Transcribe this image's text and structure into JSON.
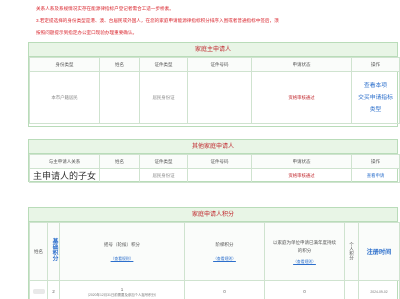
{
  "notice": {
    "line1": "关系人系及系规情况实存在能源律指标户登记者需合工适一步桥素。",
    "line2": "3.若定提选择的身份类型是港、澳、台居民或外国人，在您的家庭申请能源律指标积分排序入围或者普通指标中签后，须",
    "line3": "按照问题提示到指定办公室口现验办理重要确认。"
  },
  "main_applicant": {
    "title": "家庭主申请人",
    "headers": [
      "身份类型",
      "姓名",
      "证件类型",
      "证件号码",
      "申请状态",
      "操作"
    ],
    "row": {
      "identity": "本市户籍居民",
      "name": "",
      "id_type": "居民身份证",
      "id_number": "",
      "status": "资格审核通过",
      "ops": [
        "查看本项",
        "交买申请指标",
        "类型"
      ]
    }
  },
  "co_applicants": {
    "title": "其他家庭申请人",
    "headers": [
      "与主申请人关系",
      "姓名",
      "证件类型",
      "证件号码",
      "申请状态",
      "操作"
    ],
    "row": {
      "relation": "主申请人的子女",
      "name": "",
      "id_type": "居民身份证",
      "id_number": "",
      "status": "资格审核通过",
      "op": "查看申请"
    }
  },
  "family_score": {
    "title": "家庭申请人积分",
    "col_name": "姓名",
    "col_base_score": "基础积分",
    "col_auto_score": "摇号（轮候）积分",
    "col_auto_rule": "（查看规则）",
    "col_level": "阶梯积分",
    "col_level_rule": "（查看规则）",
    "col_join": "以家庭为单位申请已满年度持续的积分",
    "col_join_rule": "（查看规则）",
    "col_members": "个人积分",
    "col_reg_time": "注册时间",
    "row": {
      "name": "",
      "base": "2",
      "auto_value": "1",
      "auto_note": "（2020年12月31日前需要及参加个人摇号积分）",
      "level": "0",
      "join": "0",
      "members": "",
      "reg_time": "2024-09-02"
    }
  }
}
